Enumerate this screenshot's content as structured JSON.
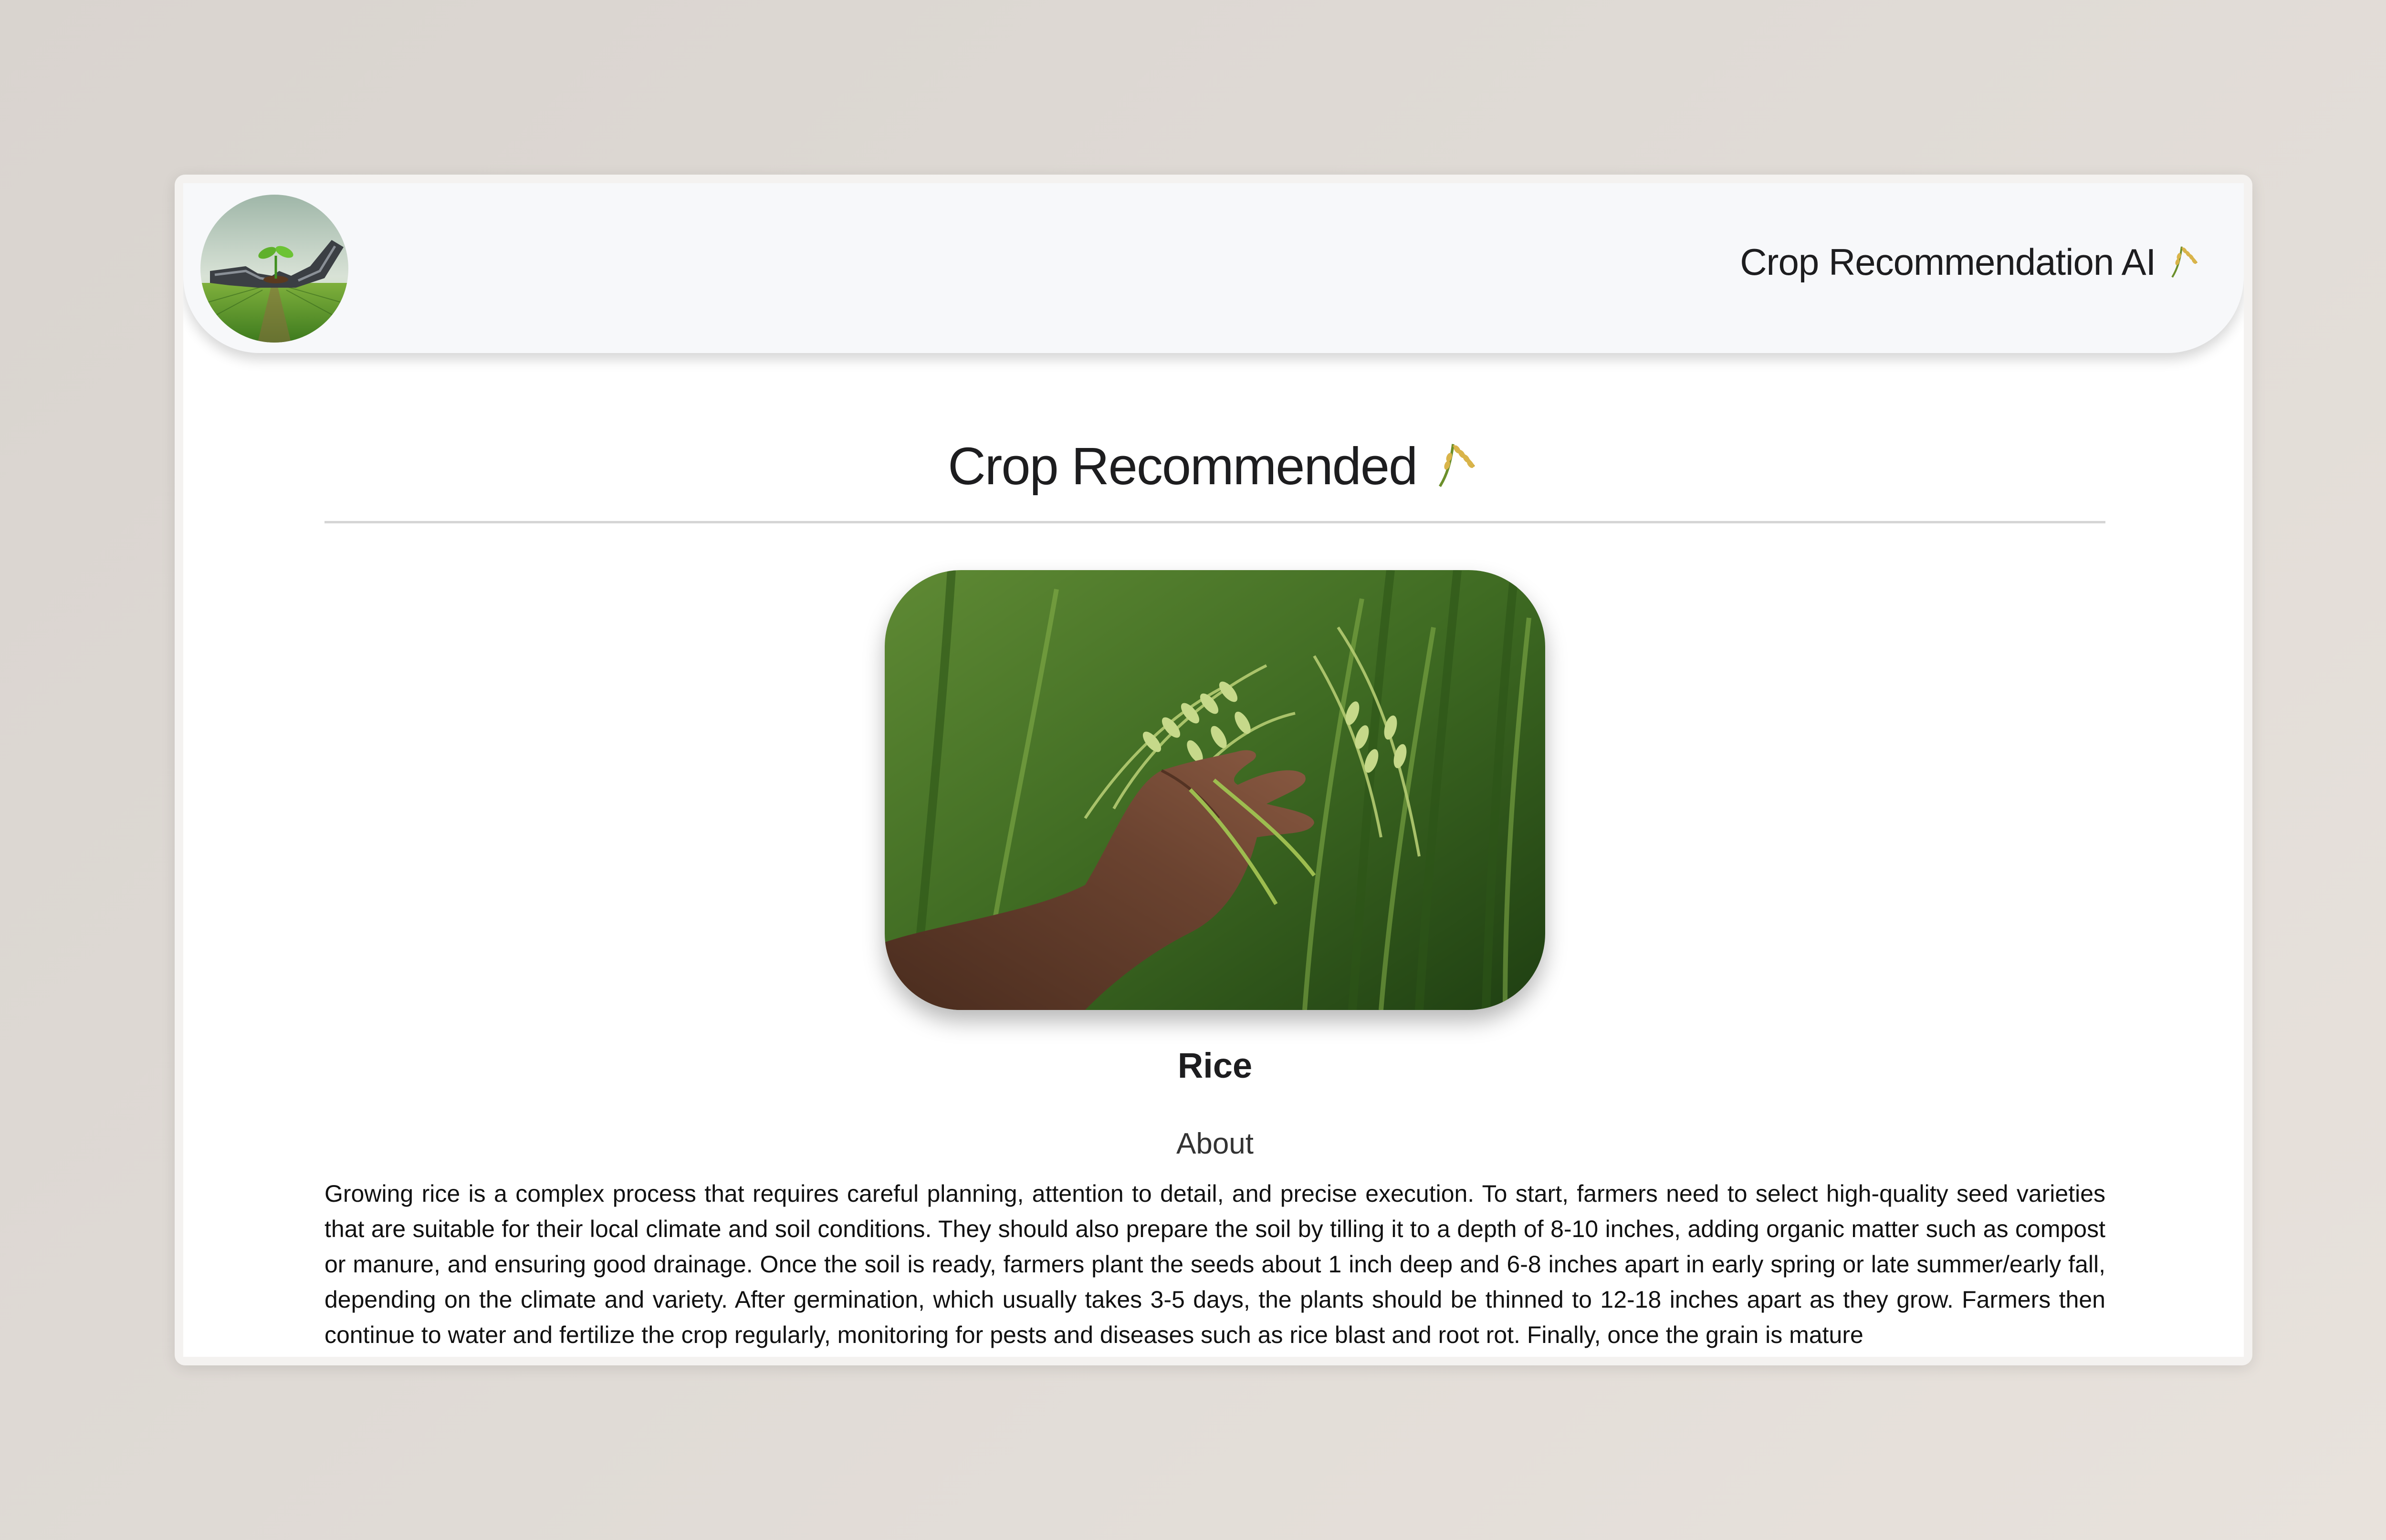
{
  "navbar": {
    "brand_title": "Crop Recommendation AI",
    "brand_icon": "rice-ear-icon",
    "logo_icon": "robot-hand-seedling-logo"
  },
  "main": {
    "heading": "Crop Recommended",
    "heading_icon": "rice-ear-icon",
    "crop_name": "Rice",
    "about_title": "About",
    "about_text": "Growing rice is a complex process that requires careful planning, attention to detail, and precise execution. To start, farmers need to select high-quality seed varieties that are suitable for their local climate and soil conditions. They should also prepare the soil by tilling it to a depth of 8-10 inches, adding organic matter such as compost or manure, and ensuring good drainage. Once the soil is ready, farmers plant the seeds about 1 inch deep and 6-8 inches apart in early spring or late summer/early fall, depending on the climate and variety. After germination, which usually takes 3-5 days, the plants should be thinned to 12-18 inches apart as they grow. Farmers then continue to water and fertilize the crop regularly, monitoring for pests and diseases such as rice blast and root rot. Finally, once the grain is mature"
  },
  "colors": {
    "background": "#dcd6d1",
    "navbar": "#f7f8fa",
    "text": "#1d1d1f"
  }
}
